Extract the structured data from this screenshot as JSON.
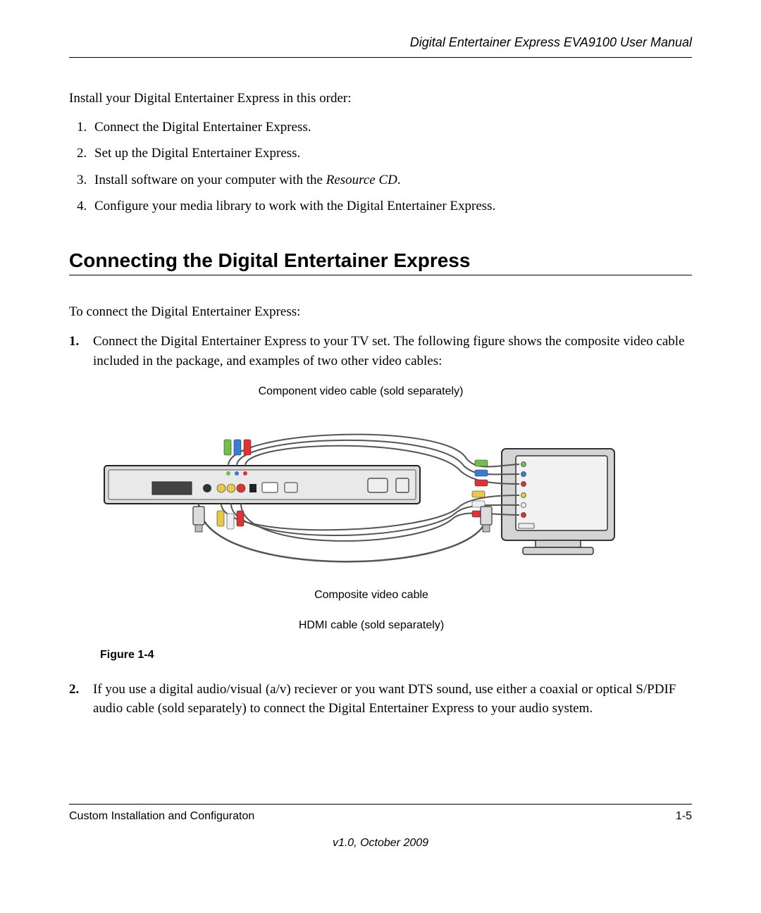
{
  "header": {
    "title": "Digital Entertainer Express EVA9100 User Manual"
  },
  "intro": "Install your Digital Entertainer Express in this order:",
  "install_steps": [
    "Connect the Digital Entertainer Express.",
    "Set up the Digital Entertainer Express.",
    {
      "pre": "Install software on your computer with the ",
      "em": "Resource CD",
      "post": "."
    },
    "Configure your media library to work with the Digital Entertainer Express."
  ],
  "section_heading": "Connecting the Digital Entertainer Express",
  "section_intro": "To connect the Digital Entertainer Express:",
  "connect_steps": [
    "Connect the Digital Entertainer Express to your TV set. The following figure shows the composite video cable included in the package, and examples of two other video cables:",
    "If you use a digital audio/visual (a/v) reciever or you want DTS sound, use either a coaxial or optical S/PDIF audio cable (sold separately) to connect the Digital Entertainer Express to your audio system."
  ],
  "figure": {
    "top_label": "Component video cable (sold separately)",
    "mid_label": "Composite video cable",
    "bottom_label": "HDMI cable (sold separately)",
    "number": "Figure 1-4"
  },
  "footer": {
    "left": "Custom Installation and Configuraton",
    "right": "1-5",
    "version": "v1.0, October 2009"
  }
}
